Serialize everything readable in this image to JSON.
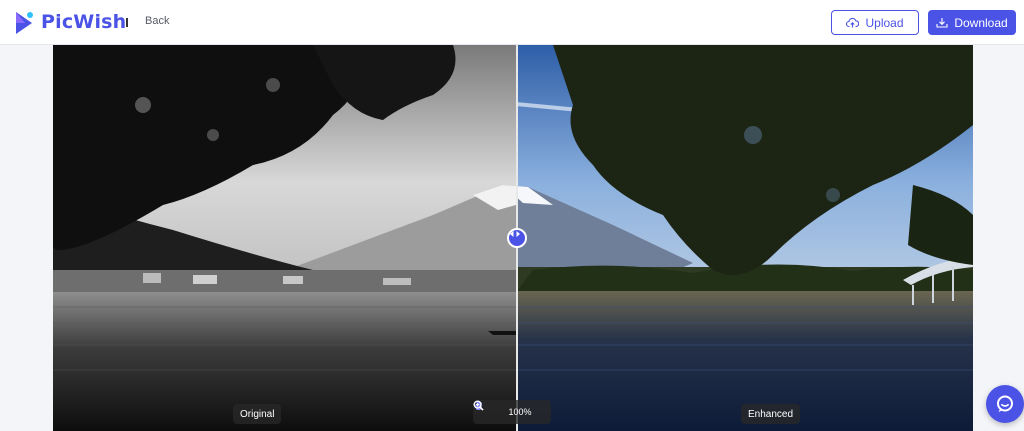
{
  "header": {
    "brand": "PicWish",
    "back_label": "Back",
    "upload_label": "Upload",
    "download_label": "Download"
  },
  "viewer": {
    "original_label": "Original",
    "enhanced_label": "Enhanced",
    "zoom_level": "100%"
  },
  "icons": {
    "logo": "picwish-logo-icon",
    "upload": "cloud-upload-icon",
    "download": "download-icon",
    "split": "split-handle-arrows-icon",
    "hand": "hand-pan-icon",
    "zoom_out": "zoom-out-icon",
    "zoom_in": "zoom-in-icon",
    "chat": "chat-bubble-icon"
  },
  "colors": {
    "brand": "#4b53e6",
    "header_bg": "#ffffff",
    "page_bg": "#f4f5f9"
  }
}
